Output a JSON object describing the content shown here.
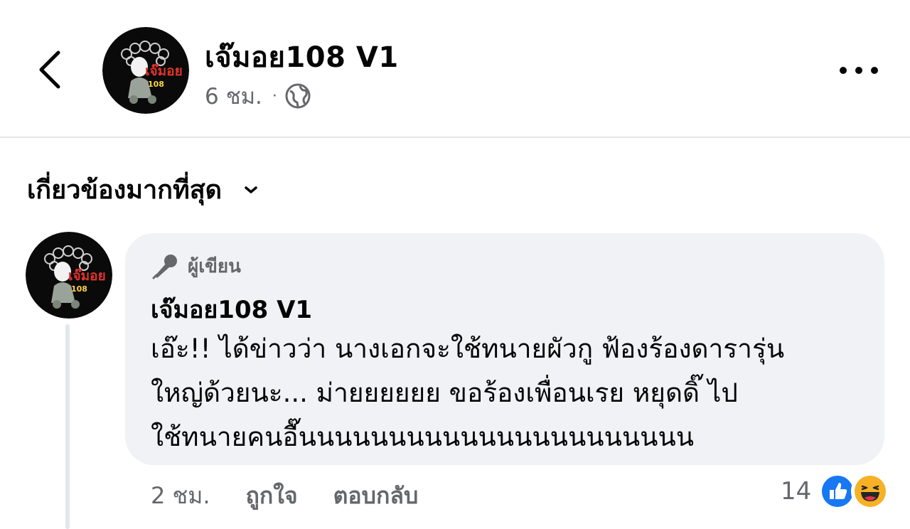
{
  "header": {
    "page_name": "เจ๊มอย108 V1",
    "time": "6 ชม.",
    "dot": "·",
    "privacy_icon": "globe-icon",
    "more_icon": "more-horizontal-icon",
    "back_icon": "chevron-left-icon"
  },
  "avatar": {
    "logo_text": "เจ๊มอย",
    "logo_number": "108"
  },
  "sort": {
    "label": "เกี่ยวข้องมากที่สุด",
    "icon": "chevron-down-icon"
  },
  "comment": {
    "badge_label": "ผู้เขียน",
    "badge_icon": "microphone-icon",
    "author": "เจ๊มอย108 V1",
    "lines": [
      "เอ๊ะ!! ได้ข่าวว่า นางเอกจะใช้ทนายผัวกู ฟ้องร้องดารารุ่น",
      "ใหญ่ด้วยนะ... ม่ายยยยยย ขอร้องเพื่อนเรย หยุดดิ๊ ไป",
      "ใช้ทนายคนอื๊นนนนนนนนนนนนนนนนนนนนนน"
    ],
    "time": "2 ชม.",
    "like_label": "ถูกใจ",
    "reply_label": "ตอบกลับ",
    "reaction_count": "14",
    "reaction_icons": [
      "like-icon",
      "haha-icon"
    ]
  },
  "colors": {
    "secondary_text": "#65676b",
    "bubble_bg": "#f0f2f5",
    "like_blue": "#1877f2",
    "haha_yellow": "#f7b125"
  }
}
